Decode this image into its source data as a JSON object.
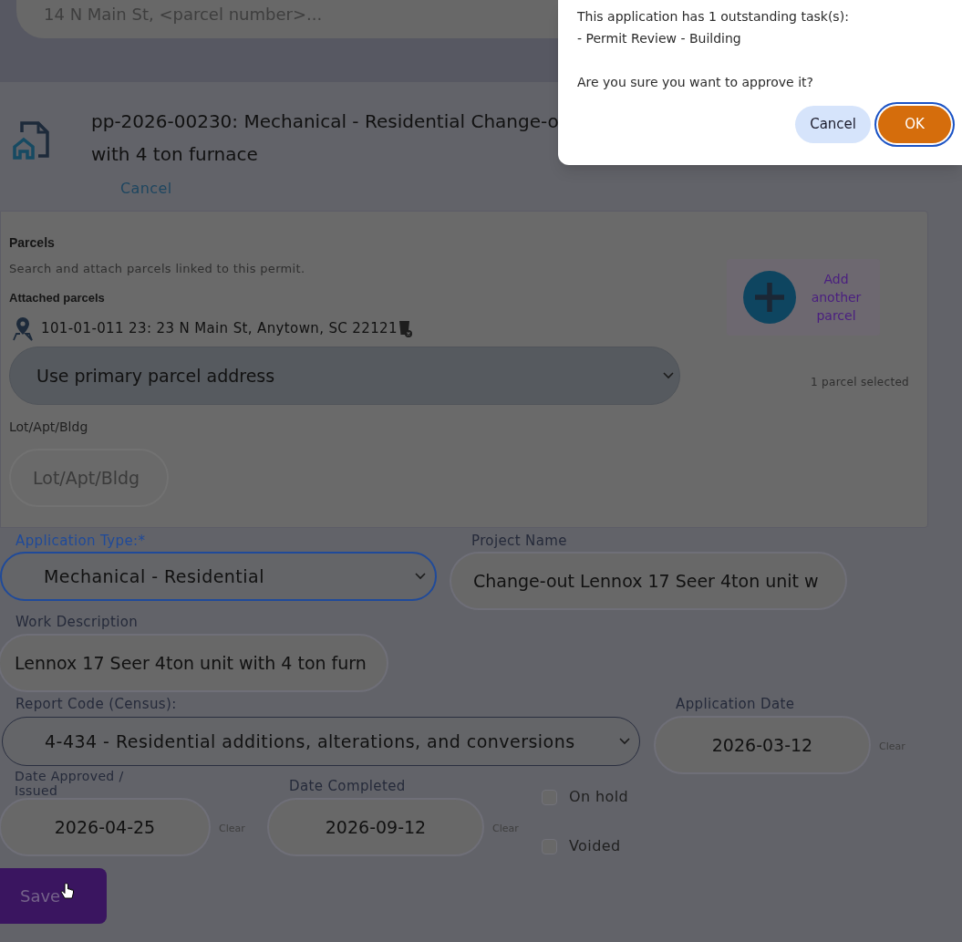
{
  "search": {
    "placeholder": "14 N Main St, <parcel number>..."
  },
  "permit": {
    "title_lines": [
      "pp-2026-00230: Mechanical - Residential Change-o",
      "with 4 ton furnace"
    ],
    "cancel": "Cancel"
  },
  "parcels": {
    "heading": "Parcels",
    "description": "Search and attach parcels linked to this permit.",
    "attached_label": "Attached parcels",
    "attached": [
      {
        "text": "101-01-011 23: 23 N Main St, Anytown, SC 22121"
      }
    ],
    "address_select": "Use primary parcel address",
    "add_button": "Add another parcel",
    "selected_count": "1 parcel selected",
    "lot_label": "Lot/Apt/Bldg",
    "lot_placeholder": "Lot/Apt/Bldg"
  },
  "form": {
    "application_type": {
      "label": "Application Type:*",
      "value": "Mechanical - Residential",
      "focused": true
    },
    "project_name": {
      "label": "Project Name",
      "value": "Change-out Lennox 17 Seer 4ton unit w"
    },
    "work_description": {
      "label": "Work Description",
      "value": "Lennox 17 Seer 4ton unit with 4 ton furn"
    },
    "report_code": {
      "label": "Report Code (Census):",
      "value": "4-434 - Residential additions, alterations, and conversions",
      "focused": false
    },
    "application_date": {
      "label": "Application Date",
      "value": "2026-03-12",
      "clear": "Clear"
    },
    "date_approved": {
      "label": "Date Approved / Issued",
      "value": "2026-04-25",
      "clear": "Clear"
    },
    "date_completed": {
      "label": "Date Completed",
      "value": "2026-09-12",
      "clear": "Clear"
    },
    "checkboxes": [
      {
        "label": "On hold",
        "checked": false
      },
      {
        "label": "Voided",
        "checked": false
      }
    ],
    "save": "Save"
  },
  "dialog": {
    "lines": [
      "This application has 1 outstanding task(s):",
      "- Permit Review - Building"
    ],
    "question": "Are you sure you want to approve it?",
    "buttons": [
      {
        "label": "Cancel",
        "kind": "secondary",
        "focused": false
      },
      {
        "label": "OK",
        "kind": "primary",
        "focused": true
      }
    ]
  }
}
